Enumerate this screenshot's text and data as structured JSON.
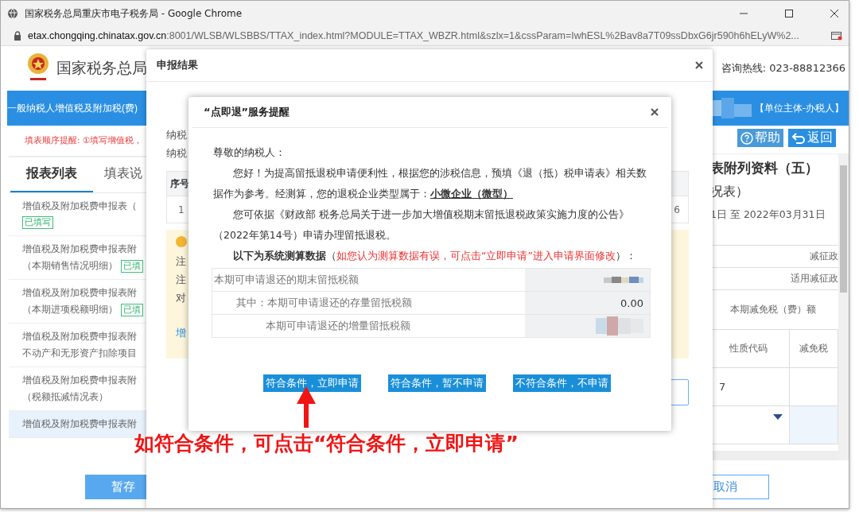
{
  "browser": {
    "title": "国家税务总局重庆市电子税务局 - Google Chrome",
    "url_host": "etax.chongqing.chinatax.gov.cn",
    "url_rest": ":8001/WLSB/WLSBBS/TTAX_index.html?MODULE=TTAX_WBZR.html&szlx=1&cssParam=IwhESL%2Bav8a7T09ssDbxG6jr590h6hELyW%2..."
  },
  "header": {
    "site_title": "国家税务总局",
    "hotline": "咨询热线: 023-88812366"
  },
  "banner": {
    "title": "一般纳税人增值税及附加税(费)",
    "role": "【单位主体-办税人】"
  },
  "sidebar": {
    "notice": "填表顺序提醒: ①填写增值税，",
    "tabs": [
      {
        "label": "报表列表",
        "selected": true
      },
      {
        "label": "填表说",
        "selected": false
      }
    ],
    "items": [
      {
        "lines": [
          "增值税及附加税费申报表（"
        ],
        "tag": "已填写",
        "selected": false
      },
      {
        "lines": [
          "增值税及附加税费申报表附",
          "（本期销售情况明细）"
        ],
        "tag": "已填",
        "selected": false
      },
      {
        "lines": [
          "增值税及附加税费申报表附",
          "（本期进项税额明细）"
        ],
        "tag": "已填",
        "selected": false
      },
      {
        "lines": [
          "增值税及附加税费申报表附",
          "不动产和无形资产扣除项目"
        ],
        "selected": false
      },
      {
        "lines": [
          "增值税及附加税费申报表附",
          "（税额抵减情况表）"
        ],
        "selected": false
      },
      {
        "lines": [
          "增值税及附加税费申报表附"
        ],
        "selected": true
      }
    ],
    "save": "暂存"
  },
  "right": {
    "help": "帮助",
    "back": "返回",
    "title": "表附列资料（五）",
    "subtitle": "况表）",
    "period": "1日 至 2022年03月31日",
    "head_1": "减征政",
    "head_2": "适用减征政",
    "head_3": "本期减免税（费）额",
    "col_a": "性质代码",
    "col_b": "减免税",
    "cell": "7",
    "cancel": "取消"
  },
  "result_dialog": {
    "title": "申报结果",
    "labels": [
      "纳税",
      "纳税"
    ],
    "table_header": "序号",
    "row_index": "1",
    "row_tail": "6",
    "notes": [
      "注",
      "注",
      "对"
    ],
    "link": "增"
  },
  "refund_dialog": {
    "title": "“点即退”服务提醒",
    "greeting": "尊敬的纳税人：",
    "paragraphs": [
      "您好！为提高留抵退税申请便利性，根据您的涉税信息，预填《退（抵）税申请表》相关数据作为参考。经测算，您的退税企业类型属于：**小微企业（微型）**",
      "您可依据《财政部 税务总局关于进一步加大增值税期末留抵退税政策实施力度的公告》（2022年第14号）申请办理留抵退税。"
    ],
    "data_intro": "**以下为系统测算数据**（*如您认为测算数据有误，可点击“立即申请”进入申请界面修改*）：",
    "rows": [
      {
        "label": "本期可申请退还的期末留抵税额",
        "redacted": true,
        "children": [
          {
            "label": "其中：本期可申请退还的存量留抵税额",
            "value": "0.00",
            "redacted": false
          },
          {
            "label": "本期可申请退还的增量留抵税额",
            "redacted": true
          }
        ]
      }
    ],
    "buttons": [
      "符合条件，立即申请",
      "符合条件，暂不申请",
      "不符合条件，不申请"
    ]
  },
  "annotation": {
    "text": "如符合条件，可点击“符合条件，立即申请”"
  }
}
